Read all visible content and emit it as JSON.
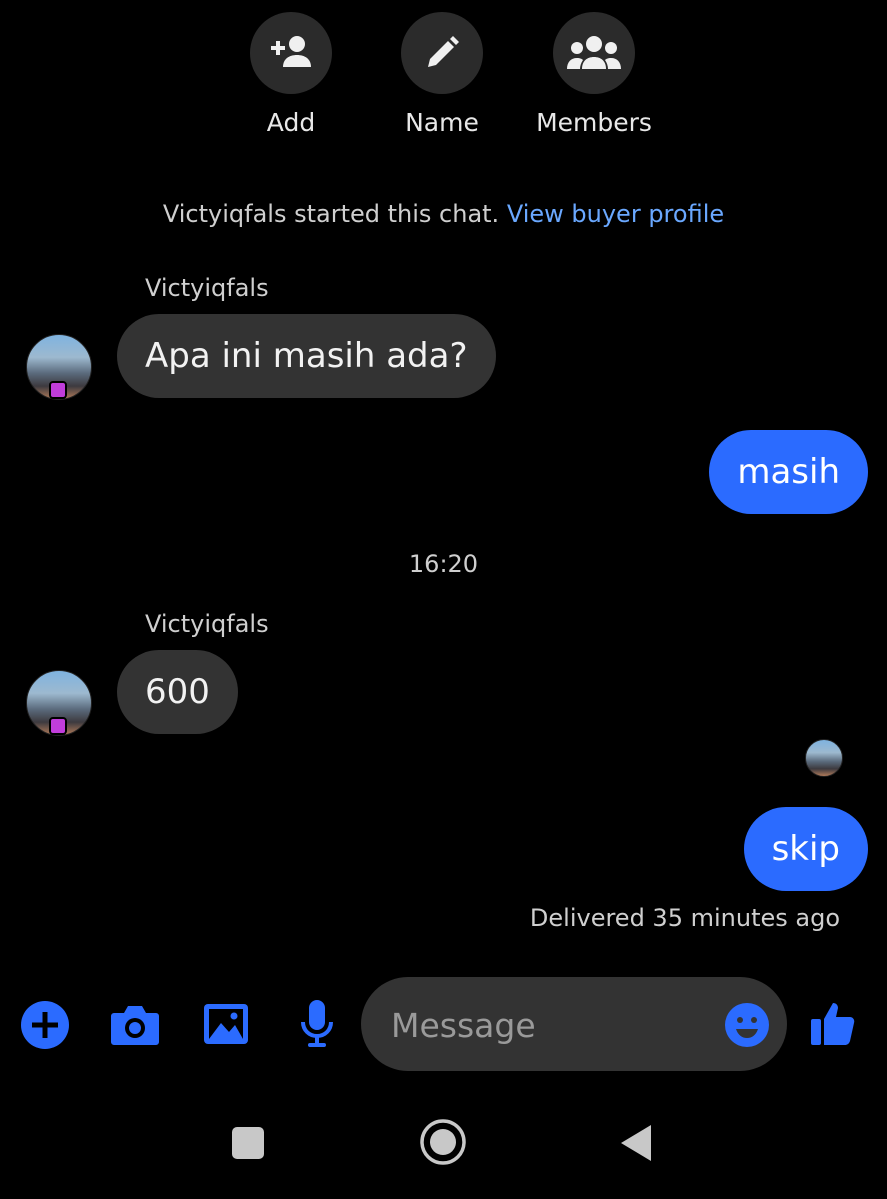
{
  "top_actions": [
    {
      "label": "Add",
      "icon": "add-person-icon"
    },
    {
      "label": "Name",
      "icon": "pencil-icon"
    },
    {
      "label": "Members",
      "icon": "group-icon"
    }
  ],
  "system": {
    "text": "Victyiqfals started this chat.",
    "link": "View buyer profile"
  },
  "messages": [
    {
      "sender": "Victyiqfals",
      "text": "Apa ini masih ada?",
      "direction": "in"
    },
    {
      "text": "masih",
      "direction": "out"
    },
    {
      "timestamp": "16:20"
    },
    {
      "sender": "Victyiqfals",
      "text": "600",
      "direction": "in"
    },
    {
      "text": "skip",
      "direction": "out"
    }
  ],
  "status": "Delivered 35 minutes ago",
  "composer": {
    "placeholder": "Message",
    "icons": [
      "plus-icon",
      "camera-icon",
      "image-icon",
      "microphone-icon",
      "emoji-icon",
      "thumbs-up-icon"
    ]
  },
  "colors": {
    "accent": "#2b6bff",
    "link": "#6aa8ff",
    "bubble_in": "#333333",
    "background": "#000000"
  },
  "nav_icons": [
    "recents-square-icon",
    "home-circle-icon",
    "back-triangle-icon"
  ]
}
